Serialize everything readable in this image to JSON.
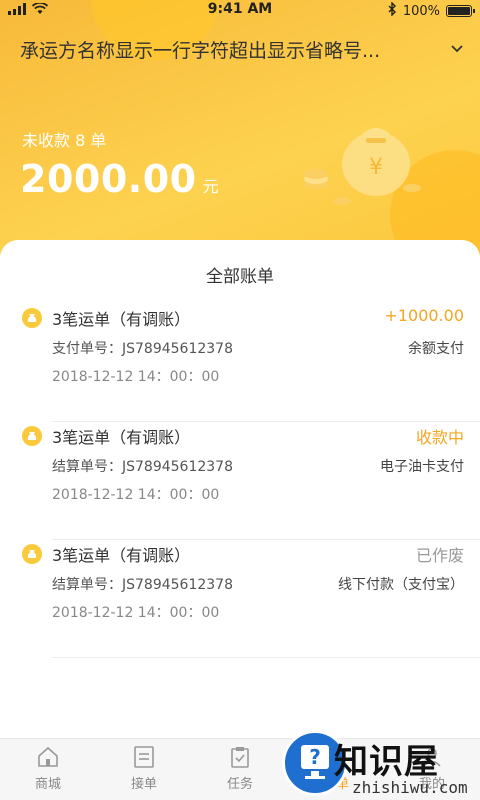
{
  "status_bar": {
    "time": "9:41 AM",
    "battery": "100%"
  },
  "header": {
    "title": "承运方名称显示一行字符超出显示省略号...",
    "unpaid_label": "未收款 8 单",
    "amount": "2000.00",
    "unit": "元"
  },
  "bill_list": {
    "title": "全部账单",
    "items": [
      {
        "name": "3笔运单（有调账）",
        "status": "+1000.00",
        "status_color": "#f5a623",
        "order": "支付单号：JS78945612378",
        "method": "余额支付",
        "time": "2018-12-12  14：00：00"
      },
      {
        "name": "3笔运单（有调账）",
        "status": "收款中",
        "status_color": "#f5a623",
        "order": "结算单号：JS78945612378",
        "method": "电子油卡支付",
        "time": "2018-12-12  14：00：00"
      },
      {
        "name": "3笔运单（有调账）",
        "status": "已作废",
        "status_color": "#999999",
        "order": "结算单号：JS78945612378",
        "method": "线下付款（支付宝）",
        "time": "2018-12-12  14：00：00"
      }
    ]
  },
  "tabbar": {
    "tabs": [
      {
        "label": "商城",
        "icon": "home-icon"
      },
      {
        "label": "接单",
        "icon": "list-icon"
      },
      {
        "label": "任务",
        "icon": "clipboard-check-icon"
      },
      {
        "label": "账单",
        "icon": "bill-icon"
      },
      {
        "label": "我的",
        "icon": "user-icon"
      }
    ]
  },
  "watermark": {
    "text": "知识屋",
    "url": "zhishiwu.com"
  },
  "colors": {
    "header_gradient_start": "#f8b93a",
    "header_gradient_end": "#fdd24f",
    "accent": "#f5a623",
    "muted": "#999999"
  }
}
